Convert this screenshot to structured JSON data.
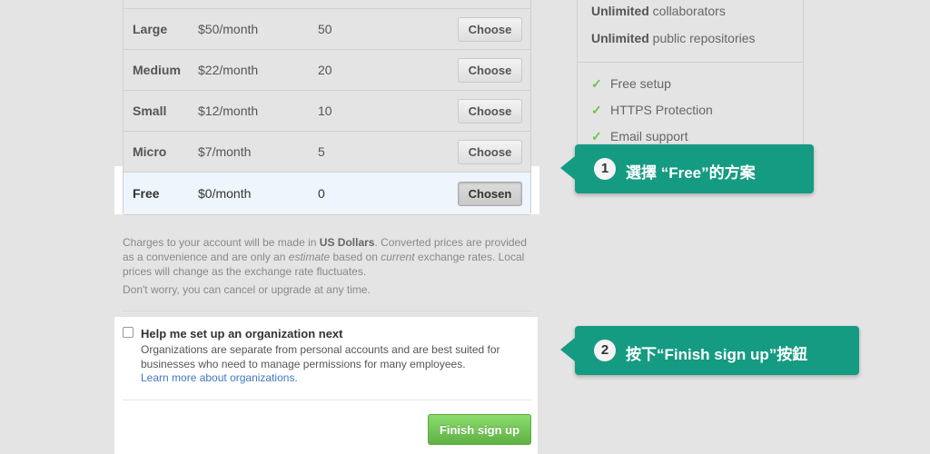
{
  "plans": {
    "rows": [
      {
        "name": "Large",
        "price": "$50/month",
        "repos": "50",
        "button": "Choose"
      },
      {
        "name": "Medium",
        "price": "$22/month",
        "repos": "20",
        "button": "Choose"
      },
      {
        "name": "Small",
        "price": "$12/month",
        "repos": "10",
        "button": "Choose"
      },
      {
        "name": "Micro",
        "price": "$7/month",
        "repos": "5",
        "button": "Choose"
      },
      {
        "name": "Free",
        "price": "$0/month",
        "repos": "0",
        "button": "Chosen"
      }
    ]
  },
  "notes": {
    "p1_a": "Charges to your account will be made in ",
    "p1_b": "US Dollars",
    "p1_c": ". Converted prices are provided as a convenience and are only an ",
    "p1_d": "estimate",
    "p1_e": " based on ",
    "p1_f": "current",
    "p1_g": " exchange rates. Local prices will change as the exchange rate fluctuates.",
    "p2": "Don't worry, you can cancel or upgrade at any time."
  },
  "org": {
    "title": "Help me set up an organization next",
    "desc": "Organizations are separate from personal accounts and are best suited for businesses who need to manage permissions for many employees.",
    "link": "Learn more about organizations.",
    "finish": "Finish sign up"
  },
  "features": {
    "collab_b": "Unlimited",
    "collab": " collaborators",
    "repos_b": "Unlimited",
    "repos": " public repositories",
    "items": [
      "Free setup",
      "HTTPS Protection",
      "Email support"
    ]
  },
  "callouts": [
    {
      "num": "1",
      "text": "選擇 “Free”的方案"
    },
    {
      "num": "2",
      "text": "按下“Finish sign up”按鈕"
    }
  ]
}
